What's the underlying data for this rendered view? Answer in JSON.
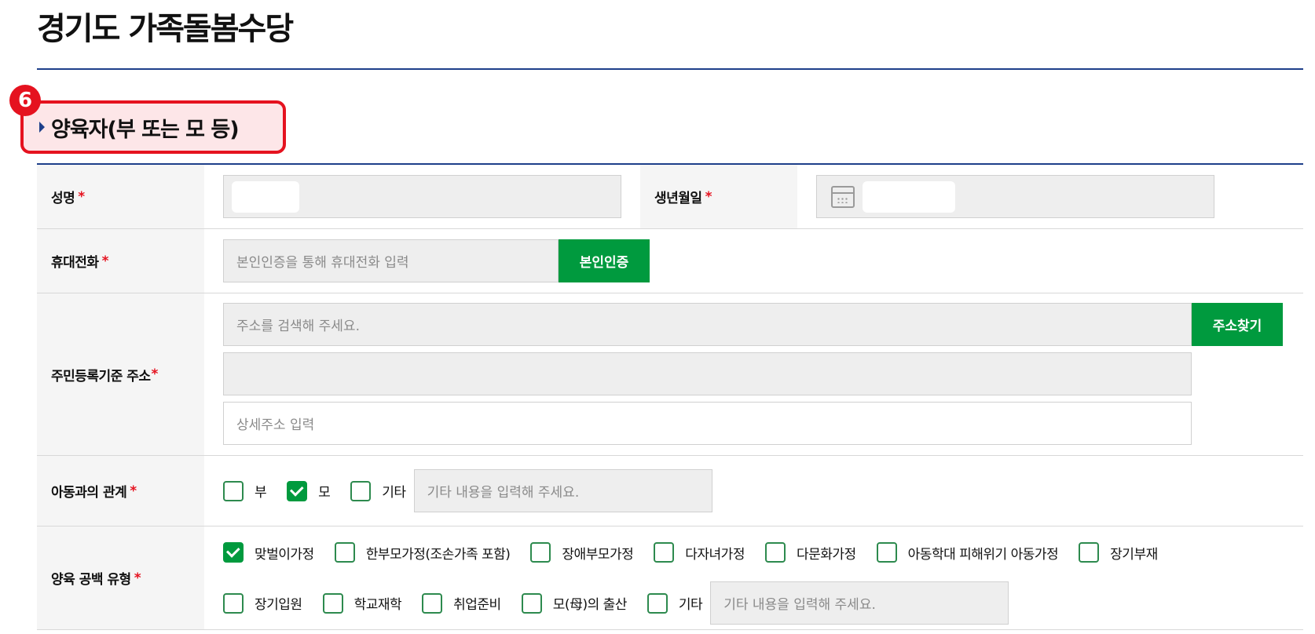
{
  "page": {
    "title": "경기도 가족돌봄수당"
  },
  "section": {
    "step": "6",
    "title": "양육자(부 또는 모 등)"
  },
  "form": {
    "name": {
      "label": "성명",
      "required_mark": "*"
    },
    "birth": {
      "label": "생년월일",
      "required_mark": "*"
    },
    "phone": {
      "label": "휴대전화",
      "required_mark": "*",
      "placeholder": "본인인증을 통해 휴대전화 입력",
      "verify_button": "본인인증"
    },
    "address": {
      "label": "주민등록기준 주소",
      "required_mark": "*",
      "search_placeholder": "주소를 검색해 주세요.",
      "search_button": "주소찾기",
      "detail_placeholder": "상세주소 입력"
    },
    "relation": {
      "label": "아동과의 관계",
      "required_mark": "*",
      "options": [
        {
          "label": "부",
          "checked": false
        },
        {
          "label": "모",
          "checked": true
        },
        {
          "label": "기타",
          "checked": false
        }
      ],
      "other_placeholder": "기타 내용을 입력해 주세요."
    },
    "care_gap": {
      "label": "양육 공백 유형",
      "required_mark": "*",
      "options_row1": [
        {
          "label": "맞벌이가정",
          "checked": true
        },
        {
          "label": "한부모가정(조손가족 포함)",
          "checked": false
        },
        {
          "label": "장애부모가정",
          "checked": false
        },
        {
          "label": "다자녀가정",
          "checked": false
        },
        {
          "label": "다문화가정",
          "checked": false
        },
        {
          "label": "아동학대 피해위기 아동가정",
          "checked": false
        },
        {
          "label": "장기부재",
          "checked": false
        }
      ],
      "options_row2": [
        {
          "label": "장기입원",
          "checked": false
        },
        {
          "label": "학교재학",
          "checked": false
        },
        {
          "label": "취업준비",
          "checked": false
        },
        {
          "label": "모(母)의 출산",
          "checked": false
        },
        {
          "label": "기타",
          "checked": false
        }
      ],
      "other_placeholder": "기타 내용을 입력해 주세요."
    }
  },
  "colors": {
    "accent_green": "#009a3e",
    "brand_navy": "#1e3f8a",
    "highlight_red": "#e5121f"
  }
}
